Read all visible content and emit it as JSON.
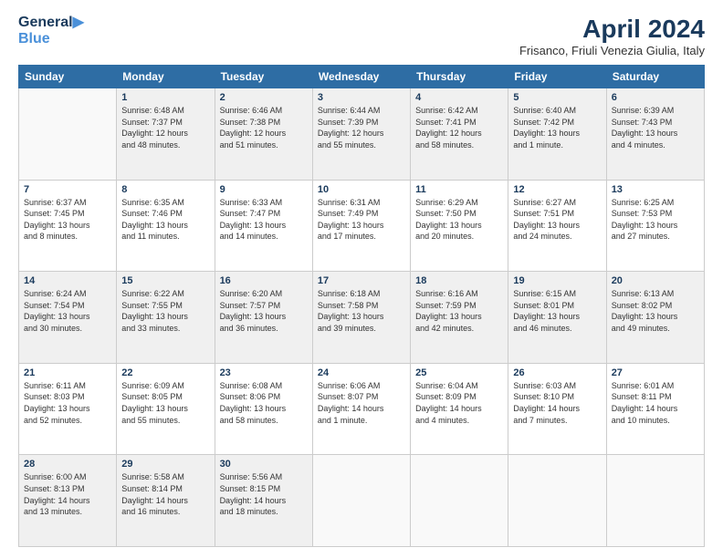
{
  "header": {
    "logo_line1": "General",
    "logo_line2": "Blue",
    "title": "April 2024",
    "subtitle": "Frisanco, Friuli Venezia Giulia, Italy"
  },
  "columns": [
    "Sunday",
    "Monday",
    "Tuesday",
    "Wednesday",
    "Thursday",
    "Friday",
    "Saturday"
  ],
  "weeks": [
    [
      {
        "num": "",
        "info": ""
      },
      {
        "num": "1",
        "info": "Sunrise: 6:48 AM\nSunset: 7:37 PM\nDaylight: 12 hours\nand 48 minutes."
      },
      {
        "num": "2",
        "info": "Sunrise: 6:46 AM\nSunset: 7:38 PM\nDaylight: 12 hours\nand 51 minutes."
      },
      {
        "num": "3",
        "info": "Sunrise: 6:44 AM\nSunset: 7:39 PM\nDaylight: 12 hours\nand 55 minutes."
      },
      {
        "num": "4",
        "info": "Sunrise: 6:42 AM\nSunset: 7:41 PM\nDaylight: 12 hours\nand 58 minutes."
      },
      {
        "num": "5",
        "info": "Sunrise: 6:40 AM\nSunset: 7:42 PM\nDaylight: 13 hours\nand 1 minute."
      },
      {
        "num": "6",
        "info": "Sunrise: 6:39 AM\nSunset: 7:43 PM\nDaylight: 13 hours\nand 4 minutes."
      }
    ],
    [
      {
        "num": "7",
        "info": "Sunrise: 6:37 AM\nSunset: 7:45 PM\nDaylight: 13 hours\nand 8 minutes."
      },
      {
        "num": "8",
        "info": "Sunrise: 6:35 AM\nSunset: 7:46 PM\nDaylight: 13 hours\nand 11 minutes."
      },
      {
        "num": "9",
        "info": "Sunrise: 6:33 AM\nSunset: 7:47 PM\nDaylight: 13 hours\nand 14 minutes."
      },
      {
        "num": "10",
        "info": "Sunrise: 6:31 AM\nSunset: 7:49 PM\nDaylight: 13 hours\nand 17 minutes."
      },
      {
        "num": "11",
        "info": "Sunrise: 6:29 AM\nSunset: 7:50 PM\nDaylight: 13 hours\nand 20 minutes."
      },
      {
        "num": "12",
        "info": "Sunrise: 6:27 AM\nSunset: 7:51 PM\nDaylight: 13 hours\nand 24 minutes."
      },
      {
        "num": "13",
        "info": "Sunrise: 6:25 AM\nSunset: 7:53 PM\nDaylight: 13 hours\nand 27 minutes."
      }
    ],
    [
      {
        "num": "14",
        "info": "Sunrise: 6:24 AM\nSunset: 7:54 PM\nDaylight: 13 hours\nand 30 minutes."
      },
      {
        "num": "15",
        "info": "Sunrise: 6:22 AM\nSunset: 7:55 PM\nDaylight: 13 hours\nand 33 minutes."
      },
      {
        "num": "16",
        "info": "Sunrise: 6:20 AM\nSunset: 7:57 PM\nDaylight: 13 hours\nand 36 minutes."
      },
      {
        "num": "17",
        "info": "Sunrise: 6:18 AM\nSunset: 7:58 PM\nDaylight: 13 hours\nand 39 minutes."
      },
      {
        "num": "18",
        "info": "Sunrise: 6:16 AM\nSunset: 7:59 PM\nDaylight: 13 hours\nand 42 minutes."
      },
      {
        "num": "19",
        "info": "Sunrise: 6:15 AM\nSunset: 8:01 PM\nDaylight: 13 hours\nand 46 minutes."
      },
      {
        "num": "20",
        "info": "Sunrise: 6:13 AM\nSunset: 8:02 PM\nDaylight: 13 hours\nand 49 minutes."
      }
    ],
    [
      {
        "num": "21",
        "info": "Sunrise: 6:11 AM\nSunset: 8:03 PM\nDaylight: 13 hours\nand 52 minutes."
      },
      {
        "num": "22",
        "info": "Sunrise: 6:09 AM\nSunset: 8:05 PM\nDaylight: 13 hours\nand 55 minutes."
      },
      {
        "num": "23",
        "info": "Sunrise: 6:08 AM\nSunset: 8:06 PM\nDaylight: 13 hours\nand 58 minutes."
      },
      {
        "num": "24",
        "info": "Sunrise: 6:06 AM\nSunset: 8:07 PM\nDaylight: 14 hours\nand 1 minute."
      },
      {
        "num": "25",
        "info": "Sunrise: 6:04 AM\nSunset: 8:09 PM\nDaylight: 14 hours\nand 4 minutes."
      },
      {
        "num": "26",
        "info": "Sunrise: 6:03 AM\nSunset: 8:10 PM\nDaylight: 14 hours\nand 7 minutes."
      },
      {
        "num": "27",
        "info": "Sunrise: 6:01 AM\nSunset: 8:11 PM\nDaylight: 14 hours\nand 10 minutes."
      }
    ],
    [
      {
        "num": "28",
        "info": "Sunrise: 6:00 AM\nSunset: 8:13 PM\nDaylight: 14 hours\nand 13 minutes."
      },
      {
        "num": "29",
        "info": "Sunrise: 5:58 AM\nSunset: 8:14 PM\nDaylight: 14 hours\nand 16 minutes."
      },
      {
        "num": "30",
        "info": "Sunrise: 5:56 AM\nSunset: 8:15 PM\nDaylight: 14 hours\nand 18 minutes."
      },
      {
        "num": "",
        "info": ""
      },
      {
        "num": "",
        "info": ""
      },
      {
        "num": "",
        "info": ""
      },
      {
        "num": "",
        "info": ""
      }
    ]
  ]
}
